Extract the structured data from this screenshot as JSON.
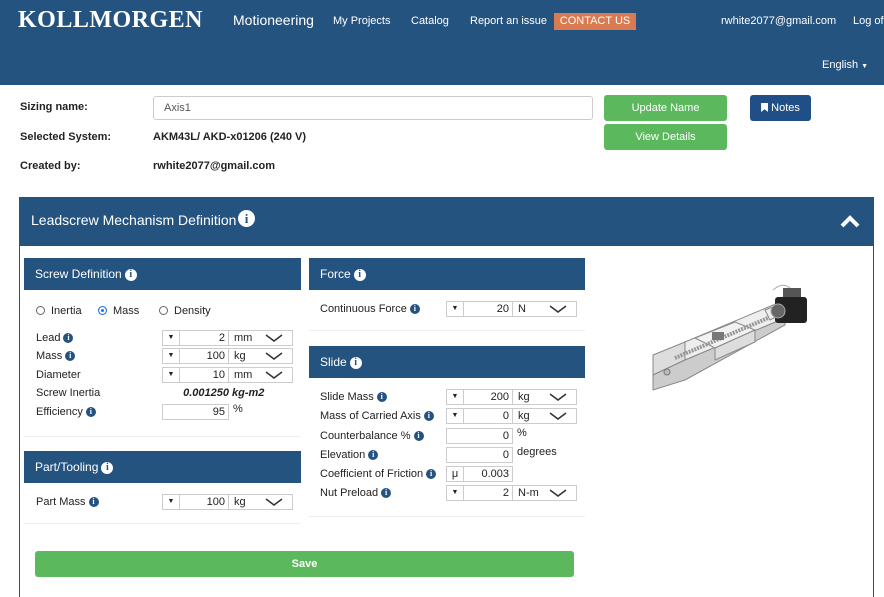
{
  "header": {
    "logo": "KOLLMORGEN",
    "app": "Motioneering",
    "nav": [
      "My Projects",
      "Catalog",
      "Report an issue"
    ],
    "contact": "CONTACT US",
    "user": "rwhite2077@gmail.com",
    "logout": "Log of",
    "language": "English"
  },
  "info": {
    "sizing_label": "Sizing name:",
    "sizing_value": "Axis1",
    "system_label": "Selected System:",
    "system_value": "AKM43L/ AKD-x01206 (240 V)",
    "created_label": "Created by:",
    "created_value": "rwhite2077@gmail.com",
    "update_btn": "Update Name",
    "details_btn": "View Details",
    "notes_btn": "Notes"
  },
  "panel": {
    "title": "Leadscrew Mechanism Definition",
    "save": "Save"
  },
  "screw": {
    "title": "Screw Definition",
    "radios": [
      {
        "label": "Inertia",
        "checked": false
      },
      {
        "label": "Mass",
        "checked": true
      },
      {
        "label": "Density",
        "checked": false
      }
    ],
    "rows": [
      {
        "label": "Lead",
        "info": true,
        "value": "2",
        "unit": "mm",
        "type": "dd"
      },
      {
        "label": "Mass",
        "info": true,
        "value": "100",
        "unit": "kg",
        "type": "dd"
      },
      {
        "label": "Diameter",
        "info": false,
        "value": "10",
        "unit": "mm",
        "type": "dd"
      },
      {
        "label": "Screw Inertia",
        "info": false,
        "value": "0.001250",
        "unit": "kg-m2",
        "type": "ro"
      },
      {
        "label": "Efficiency",
        "info": true,
        "value": "95",
        "unit": "%",
        "type": "plain"
      }
    ]
  },
  "part": {
    "title": "Part/Tooling",
    "rows": [
      {
        "label": "Part Mass",
        "info": true,
        "value": "100",
        "unit": "kg",
        "type": "dd"
      }
    ]
  },
  "force": {
    "title": "Force",
    "rows": [
      {
        "label": "Continuous Force",
        "info": true,
        "value": "20",
        "unit": "N",
        "type": "dd"
      }
    ]
  },
  "slide": {
    "title": "Slide",
    "rows": [
      {
        "label": "Slide Mass",
        "info": true,
        "value": "200",
        "unit": "kg",
        "type": "dd"
      },
      {
        "label": "Mass of Carried Axis",
        "info": true,
        "value": "0",
        "unit": "kg",
        "type": "dd"
      },
      {
        "label": "Counterbalance %",
        "info": true,
        "value": "0",
        "unit": "%",
        "type": "plain"
      },
      {
        "label": "Elevation",
        "info": true,
        "value": "0",
        "unit": "degrees",
        "type": "plain"
      },
      {
        "label": "Coefficient of Friction",
        "info": true,
        "value": "0.003",
        "unit": "μ",
        "type": "mu"
      },
      {
        "label": "Nut Preload",
        "info": true,
        "value": "2",
        "unit": "N-m",
        "type": "dd"
      }
    ]
  },
  "colors": {
    "brand": "#245380",
    "green": "#5cb85c",
    "contact": "#d97a50"
  }
}
